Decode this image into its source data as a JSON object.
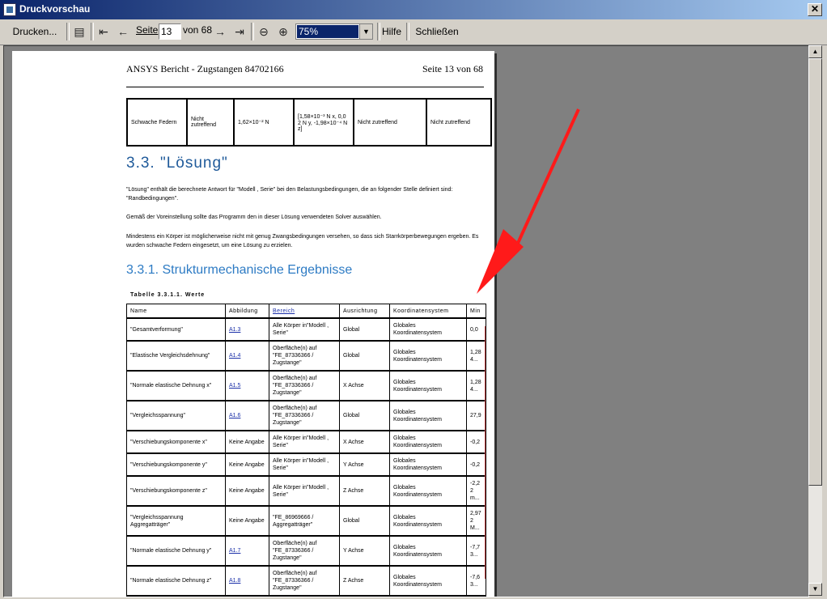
{
  "window": {
    "title": "Druckvorschau",
    "close": "✕"
  },
  "toolbar": {
    "print": "Drucken...",
    "page_label": "Seite",
    "page_value": "13",
    "of_label": "von 68",
    "zoom_value": "75%",
    "help": "Hilfe",
    "close": "Schließen"
  },
  "page": {
    "header_left": "ANSYS Bericht - Zugstangen 84702166",
    "header_right": "Seite 13 von 68",
    "top_table_row": [
      "Schwache Federn",
      "Nicht zutreffend",
      "1,62×10⁻² N",
      "[1,58×10⁻³ N x, 0,0 2 N y, -1,98×10⁻⁴ N z]",
      "Nicht zutreffend",
      "Nicht zutreffend"
    ],
    "section_title": "3.3. \"Lösung\"",
    "para1": "\"Lösung\" enthält die berechnete Antwort für \"Modell , Serie\" bei den Belastungsbedingungen, die an folgender Stelle definiert sind: \"Randbedingungen\".",
    "para2": "Gemäß der Voreinstellung sollte das Programm den in dieser Lösung verwendeten Solver auswählen.",
    "para3": "Mindestens ein Körper ist möglicherweise nicht mit genug Zwangsbedingungen versehen, so dass sich Starrkörperbewegungen ergeben. Es wurden schwache Federn eingesetzt, um eine Lösung zu erzielen.",
    "subsection_title": "3.3.1. Strukturmechanische Ergebnisse",
    "table_caption": "Tabelle 3.3.1.1. Werte",
    "columns": [
      "Name",
      "Abbildung",
      "Bereich",
      "Ausrichtung",
      "Koordinatensystem",
      "Min"
    ],
    "rows": [
      {
        "name": "\"Gesamtverformung\"",
        "fig": "A1.3",
        "range": "Alle Körper in\"Modell , Serie\"",
        "dir": "Global",
        "cs": "Globales Koordinatensystem",
        "min": "0,0"
      },
      {
        "name": "\"Elastische Vergleichsdehnung\"",
        "fig": "A1.4",
        "range": "Oberfläche(n) auf \"FE_87336366 / Zugstange\"",
        "dir": "Global",
        "cs": "Globales Koordinatensystem",
        "min": "1,28 4..."
      },
      {
        "name": "\"Normale elastische Dehnung x\"",
        "fig": "A1.5",
        "range": "Oberfläche(n) auf \"FE_87336366 / Zugstange\"",
        "dir": "X Achse",
        "cs": "Globales Koordinatensystem",
        "min": "1,28 4..."
      },
      {
        "name": "\"Vergleichsspannung\"",
        "fig": "A1.6",
        "range": "Oberfläche(n) auf \"FE_87336366 / Zugstange\"",
        "dir": "Global",
        "cs": "Globales Koordinatensystem",
        "min": "27,9"
      },
      {
        "name": "\"Verschiebungskomponente x\"",
        "fig": "Keine Angabe",
        "range": "Alle Körper in\"Modell , Serie\"",
        "dir": "X Achse",
        "cs": "Globales Koordinatensystem",
        "min": "-0,2"
      },
      {
        "name": "\"Verschiebungskomponente y\"",
        "fig": "Keine Angabe",
        "range": "Alle Körper in\"Modell , Serie\"",
        "dir": "Y Achse",
        "cs": "Globales Koordinatensystem",
        "min": "-0,2"
      },
      {
        "name": "\"Verschiebungskomponente z\"",
        "fig": "Keine Angabe",
        "range": "Alle Körper in\"Modell , Serie\"",
        "dir": "Z Achse",
        "cs": "Globales Koordinatensystem",
        "min": "-2,2 2 m..."
      },
      {
        "name": "\"Vergleichsspannung Aggregatträger\"",
        "fig": "Keine Angabe",
        "range": "\"FE_86969666 / Aggregatträger\"",
        "dir": "Global",
        "cs": "Globales Koordinatensystem",
        "min": "2,97 2 M..."
      },
      {
        "name": "\"Normale elastische Dehnung y\"",
        "fig": "A1.7",
        "range": "Oberfläche(n) auf \"FE_87336366 / Zugstange\"",
        "dir": "Y Achse",
        "cs": "Globales Koordinatensystem",
        "min": "-7,7 3..."
      },
      {
        "name": "\"Normale elastische Dehnung z\"",
        "fig": "A1.8",
        "range": "Oberfläche(n) auf \"FE_87336366 / Zugstange\"",
        "dir": "Z Achse",
        "cs": "Globales Koordinatensystem",
        "min": "-7,6 3..."
      }
    ]
  }
}
